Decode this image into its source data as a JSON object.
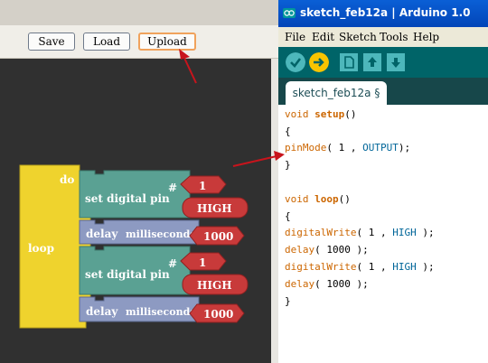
{
  "blockly_toolbar": {
    "save_label": "Save",
    "load_label": "Load",
    "upload_label": "Upload"
  },
  "blocks": {
    "loop_label": "loop",
    "do_label": "do",
    "set_pin_label": "set digital pin",
    "hash_label": "#",
    "pin_value": "1",
    "state_value": "HIGH",
    "delay_label": "delay",
    "milliseconds_label": "milliseconds",
    "delay_value": "1000"
  },
  "arduino": {
    "title": "sketch_feb12a | Arduino 1.0",
    "menu": [
      "File",
      "Edit",
      "Sketch",
      "Tools",
      "Help"
    ],
    "tab_label": "sketch_feb12a §",
    "code": {
      "setup_void": "void",
      "setup_name": "setup",
      "setup_paren": "()",
      "open1": "{",
      "pinmode_fn": "pinMode",
      "pinmode_args_a": "( 1 , ",
      "pinmode_const": "OUTPUT",
      "pinmode_args_b": ");",
      "close1": "}",
      "loop_void": "void",
      "loop_name": "loop",
      "loop_paren": "()",
      "open2": "{",
      "dw_fn": "digitalWrite",
      "dw_args_a": "( 1 , ",
      "dw_const": "HIGH",
      "dw_args_b": " );",
      "delay_fn": "delay",
      "delay_args": "( 1000 );",
      "close2": "}"
    }
  },
  "colors": {
    "loop_block": "#efd32d",
    "pin_block": "#5aa193",
    "value_block": "#c83a3a",
    "delay_block": "#8d9ac2",
    "arrow": "#c8141c",
    "ide_teal": "#006468",
    "ide_button": "#f9c400"
  },
  "icons": [
    "arduino-logo-icon",
    "verify-icon",
    "upload-arrow-icon",
    "new-icon",
    "open-icon",
    "save-icon"
  ]
}
